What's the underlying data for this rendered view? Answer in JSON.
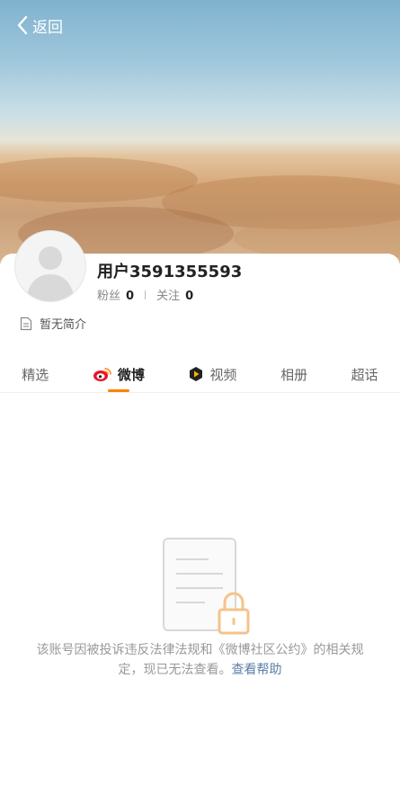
{
  "header": {
    "back_label": "返回"
  },
  "profile": {
    "name": "用户3591355593",
    "fans_label": "粉丝",
    "fans_count": "0",
    "follow_label": "关注",
    "follow_count": "0",
    "bio": "暂无简介"
  },
  "tabs": [
    {
      "label": "精选",
      "active": false
    },
    {
      "label": "微博",
      "active": true
    },
    {
      "label": "视频",
      "active": false
    },
    {
      "label": "相册",
      "active": false
    },
    {
      "label": "超话",
      "active": false
    }
  ],
  "notice": {
    "text": "该账号因被投诉违反法律法规和《微博社区公约》的相关规定，现已无法查看。",
    "help_link": "查看帮助"
  },
  "colors": {
    "accent": "#ff8200",
    "link": "#5a7ea7",
    "muted": "#999999"
  }
}
